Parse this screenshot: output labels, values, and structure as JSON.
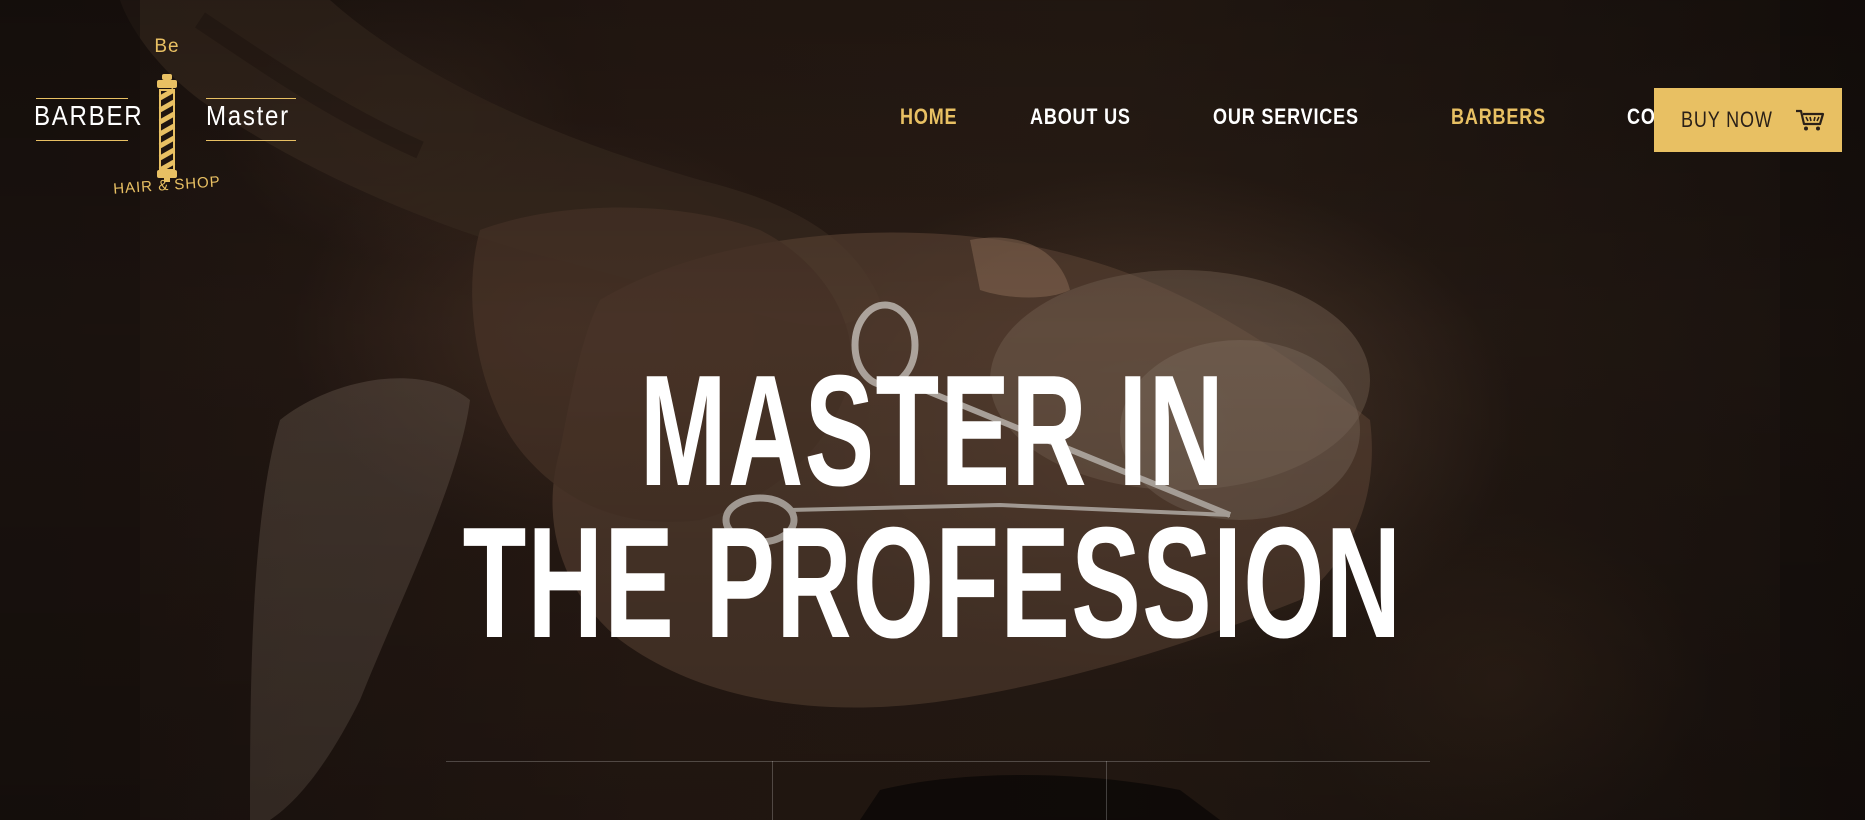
{
  "brand": {
    "prefix": "Be",
    "word_left": "BARBER",
    "word_right": "Master",
    "tagline": "HAIR & SHOP",
    "accent_color": "#e8c063"
  },
  "nav": {
    "items": [
      {
        "label": "HOME",
        "active": true
      },
      {
        "label": "ABOUT US",
        "active": false
      },
      {
        "label": "OUR SERVICES",
        "active": false
      },
      {
        "label": "BARBERS",
        "active": true
      },
      {
        "label": "CONTACT",
        "active": false
      }
    ],
    "buy_button": {
      "label": "BUY NOW",
      "icon": "cart-icon"
    }
  },
  "hero": {
    "headline_line1": "MASTER IN",
    "headline_line2": "THE PROFESSION"
  }
}
